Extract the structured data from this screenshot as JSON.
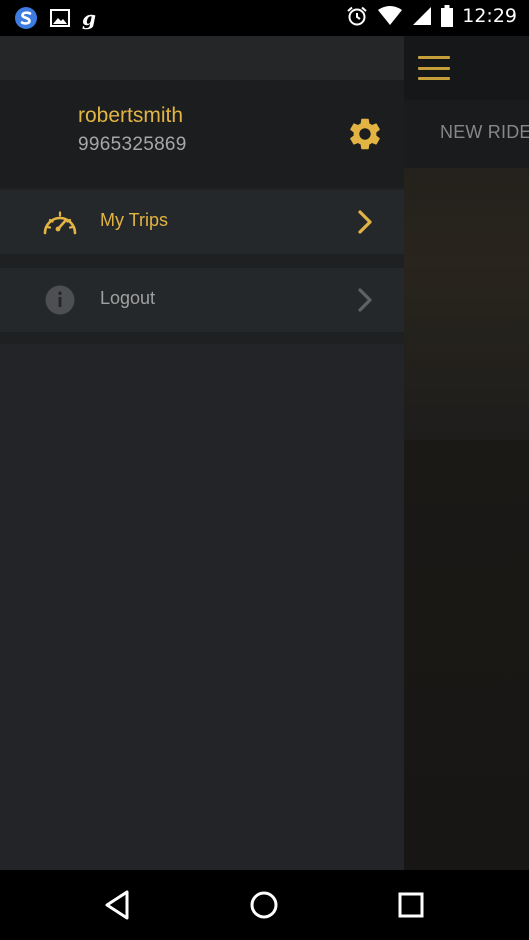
{
  "status_bar": {
    "time": "12:29",
    "left_icons": [
      "swiftkey-icon",
      "image-icon",
      "g-icon"
    ],
    "g_glyph": "g",
    "right_icons": [
      "alarm-icon",
      "wifi-icon",
      "signal-icon",
      "battery-icon"
    ]
  },
  "drawer": {
    "user": {
      "name": "robertsmith",
      "phone": "9965325869"
    },
    "settings_icon": "gear-icon",
    "items": [
      {
        "label": "My Trips",
        "icon": "speedometer-icon",
        "active": true
      },
      {
        "label": "Logout",
        "icon": "info-icon",
        "active": false
      }
    ]
  },
  "app": {
    "menu_icon": "hamburger-icon",
    "tab_label": "NEW RIDE"
  },
  "nav_bar": {
    "buttons": [
      "back-icon",
      "home-icon",
      "recents-icon"
    ]
  },
  "colors": {
    "accent": "#e2b443",
    "drawer_bg": "#222427",
    "header_bg": "#1c1d1f",
    "muted_text": "#a7a7a7"
  }
}
